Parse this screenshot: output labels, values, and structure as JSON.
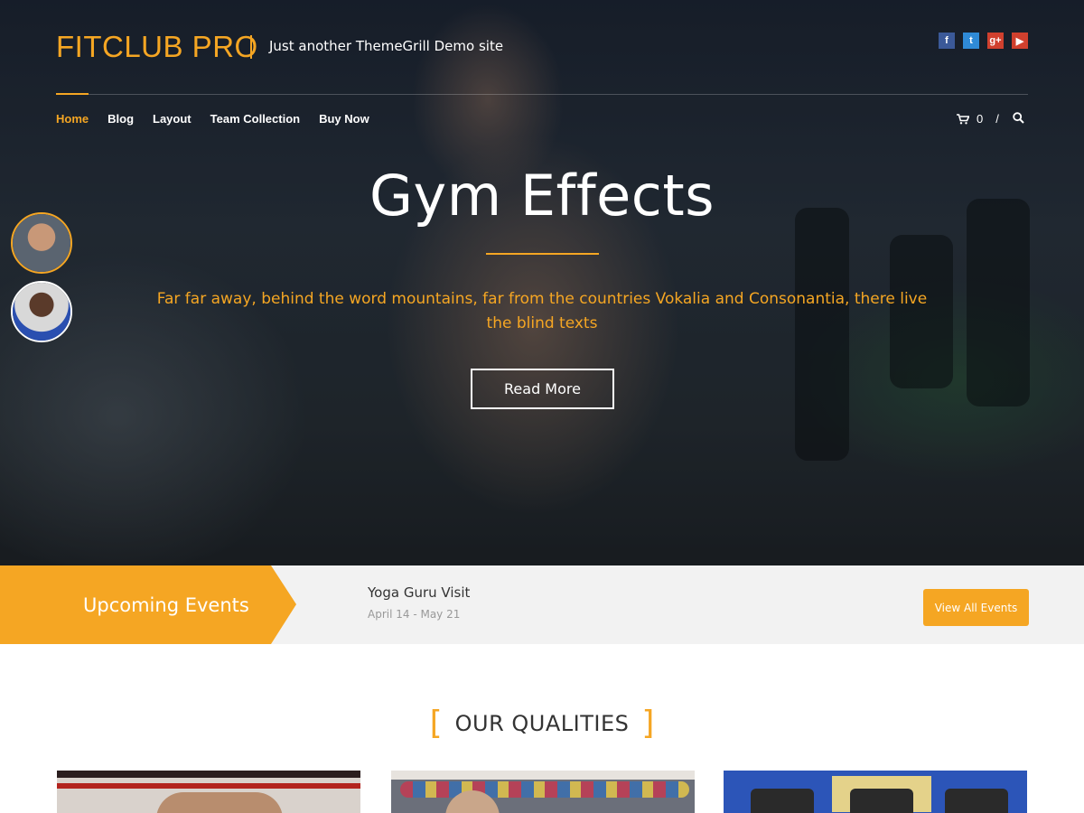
{
  "header": {
    "logo": "FITCLUB PRO",
    "tagline": "Just another ThemeGrill Demo site",
    "social": [
      {
        "icon": "facebook-icon",
        "glyph": "f",
        "color": "#3b5998"
      },
      {
        "icon": "twitter-icon",
        "glyph": "t",
        "color": "#2f8ad6"
      },
      {
        "icon": "google-plus-icon",
        "glyph": "g+",
        "color": "#d0402e"
      },
      {
        "icon": "youtube-icon",
        "glyph": "▶",
        "color": "#d0402e"
      }
    ],
    "nav": [
      "Home",
      "Blog",
      "Layout",
      "Team Collection",
      "Buy Now"
    ],
    "active_nav": "Home",
    "cart_count": "0",
    "cart_separator": "/"
  },
  "hero": {
    "title": "Gym Effects",
    "text": "Far far away, behind the word mountains, far from the countries Vokalia and Consonantia, there live the blind texts",
    "button": "Read More"
  },
  "events": {
    "label": "Upcoming Events",
    "event_title": "Yoga Guru Visit",
    "event_date": "April 14 - May 21",
    "button": "View All Events"
  },
  "qualities": {
    "bracket_left": "[",
    "title": "OUR QUALITIES",
    "bracket_right": "]"
  },
  "colors": {
    "accent": "#f5a623",
    "event_bar_bg": "#f2f2f2"
  }
}
